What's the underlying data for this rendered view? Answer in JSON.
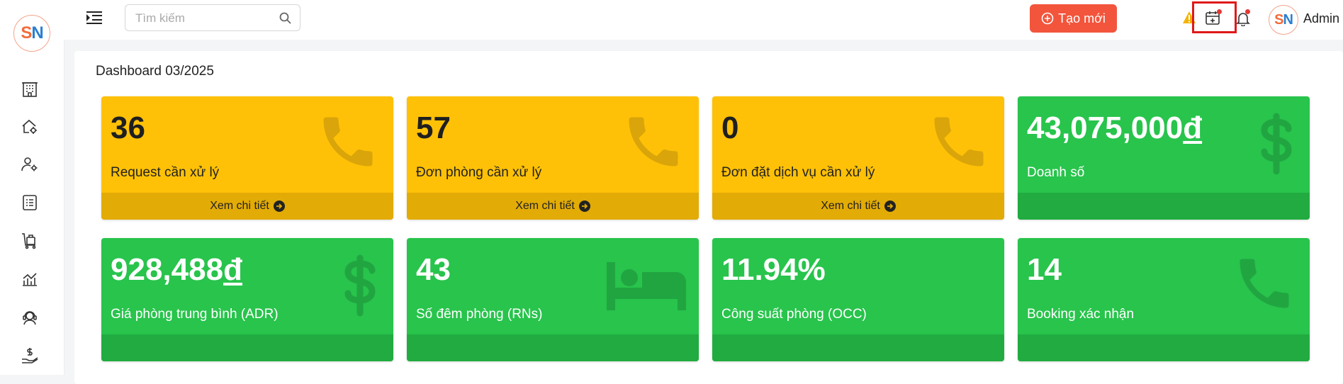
{
  "sidebar": {
    "logo": {
      "left": "S",
      "right": "N"
    },
    "items": [
      {
        "name": "hotel-icon"
      },
      {
        "name": "home-settings-icon"
      },
      {
        "name": "user-settings-icon"
      },
      {
        "name": "list-icon"
      },
      {
        "name": "luggage-icon"
      },
      {
        "name": "chart-icon"
      },
      {
        "name": "support-icon"
      },
      {
        "name": "money-hand-icon"
      }
    ]
  },
  "topbar": {
    "search_placeholder": "Tìm kiếm",
    "create_label": "Tạo mới",
    "user_name": "Admin",
    "avatar": {
      "left": "S",
      "right": "N"
    }
  },
  "dashboard": {
    "title": "Dashboard 03/2025",
    "cards": [
      {
        "value": "36",
        "label": "Request cần xử lý",
        "footer": "Xem chi tiết",
        "color": "#ffc107",
        "icon": "phone-icon"
      },
      {
        "value": "57",
        "label": "Đơn phòng cần xử lý",
        "footer": "Xem chi tiết",
        "color": "#ffc107",
        "icon": "phone-icon"
      },
      {
        "value": "0",
        "label": "Đơn đặt dịch vụ cần xử lý",
        "footer": "Xem chi tiết",
        "color": "#ffc107",
        "icon": "phone-icon"
      },
      {
        "value": "43,075,000",
        "currency": "đ",
        "label": "Doanh số",
        "color": "#28c44c",
        "icon": "dollar-icon"
      },
      {
        "value": "928,488",
        "currency": "đ",
        "label": "Giá phòng trung bình (ADR)",
        "color": "#28c44c",
        "icon": "dollar-icon"
      },
      {
        "value": "43",
        "label": "Số đêm phòng (RNs)",
        "color": "#28c44c",
        "icon": "bed-icon"
      },
      {
        "value": "11.94%",
        "label": "Công suất phòng (OCC)",
        "color": "#28c44c",
        "icon": "none"
      },
      {
        "value": "14",
        "label": "Booking xác nhận",
        "color": "#28c44c",
        "icon": "phone-icon"
      }
    ]
  },
  "colors": {
    "accent": "#f2553c",
    "warning": "#ffc107",
    "success": "#28c44c",
    "highlight": "#e01919"
  }
}
